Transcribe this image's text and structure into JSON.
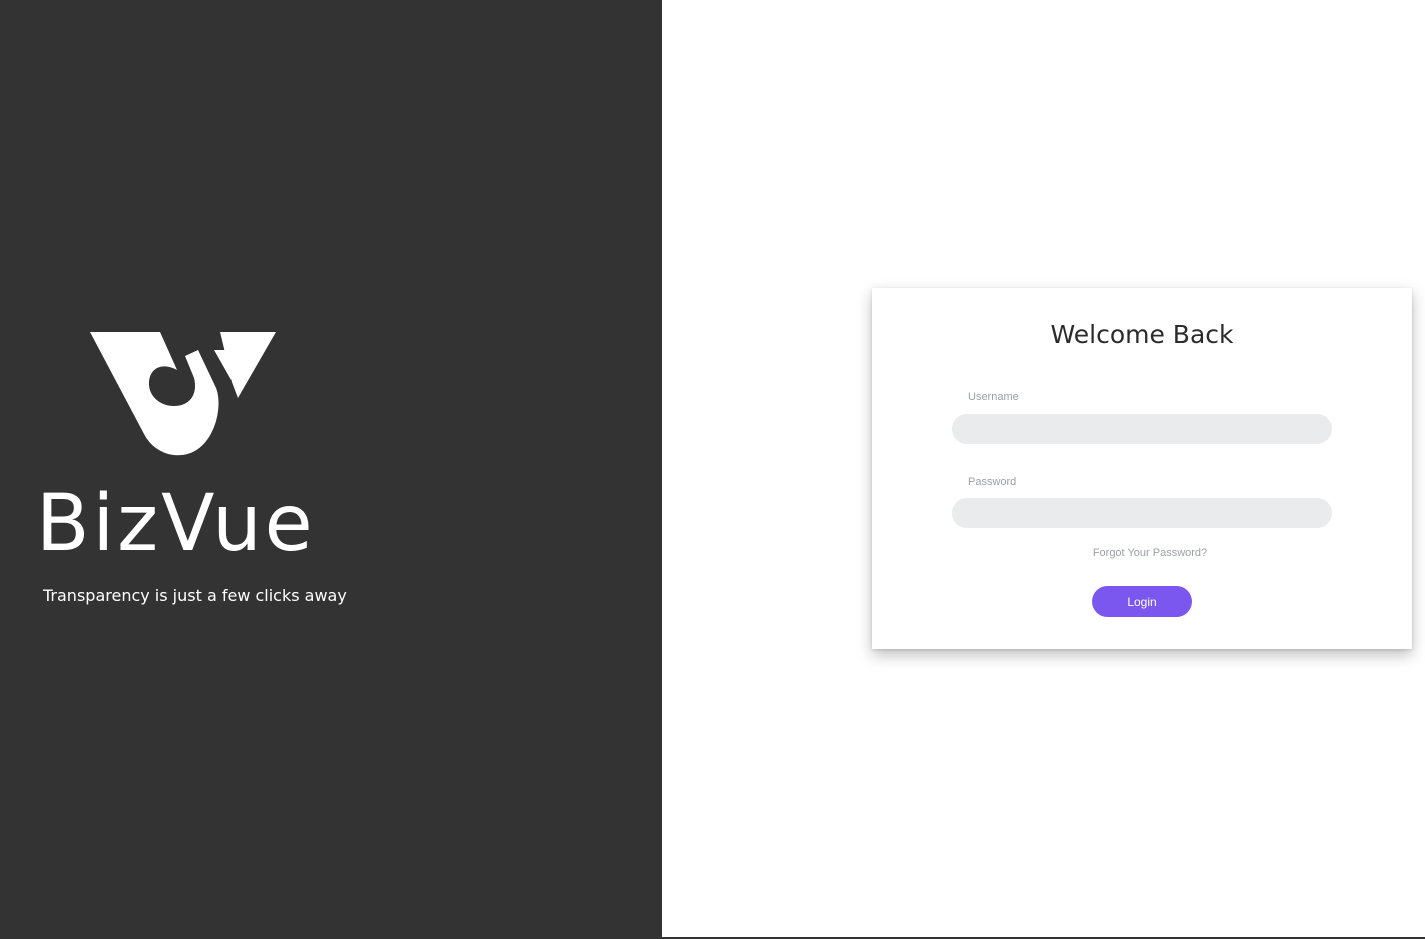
{
  "brand": {
    "name": "BizVue",
    "tagline": "Transparency is just a few clicks away",
    "panel_color": "#333333",
    "logo_icon": "bizvue-logo-mark"
  },
  "login": {
    "title": "Welcome Back",
    "username_label": "Username",
    "username_value": "",
    "password_label": "Password",
    "password_value": "",
    "forgot_password": "Forgot Your Password?",
    "login_label": "Login",
    "accent_color": "#7b57f0",
    "input_bg": "#e9ebed"
  }
}
